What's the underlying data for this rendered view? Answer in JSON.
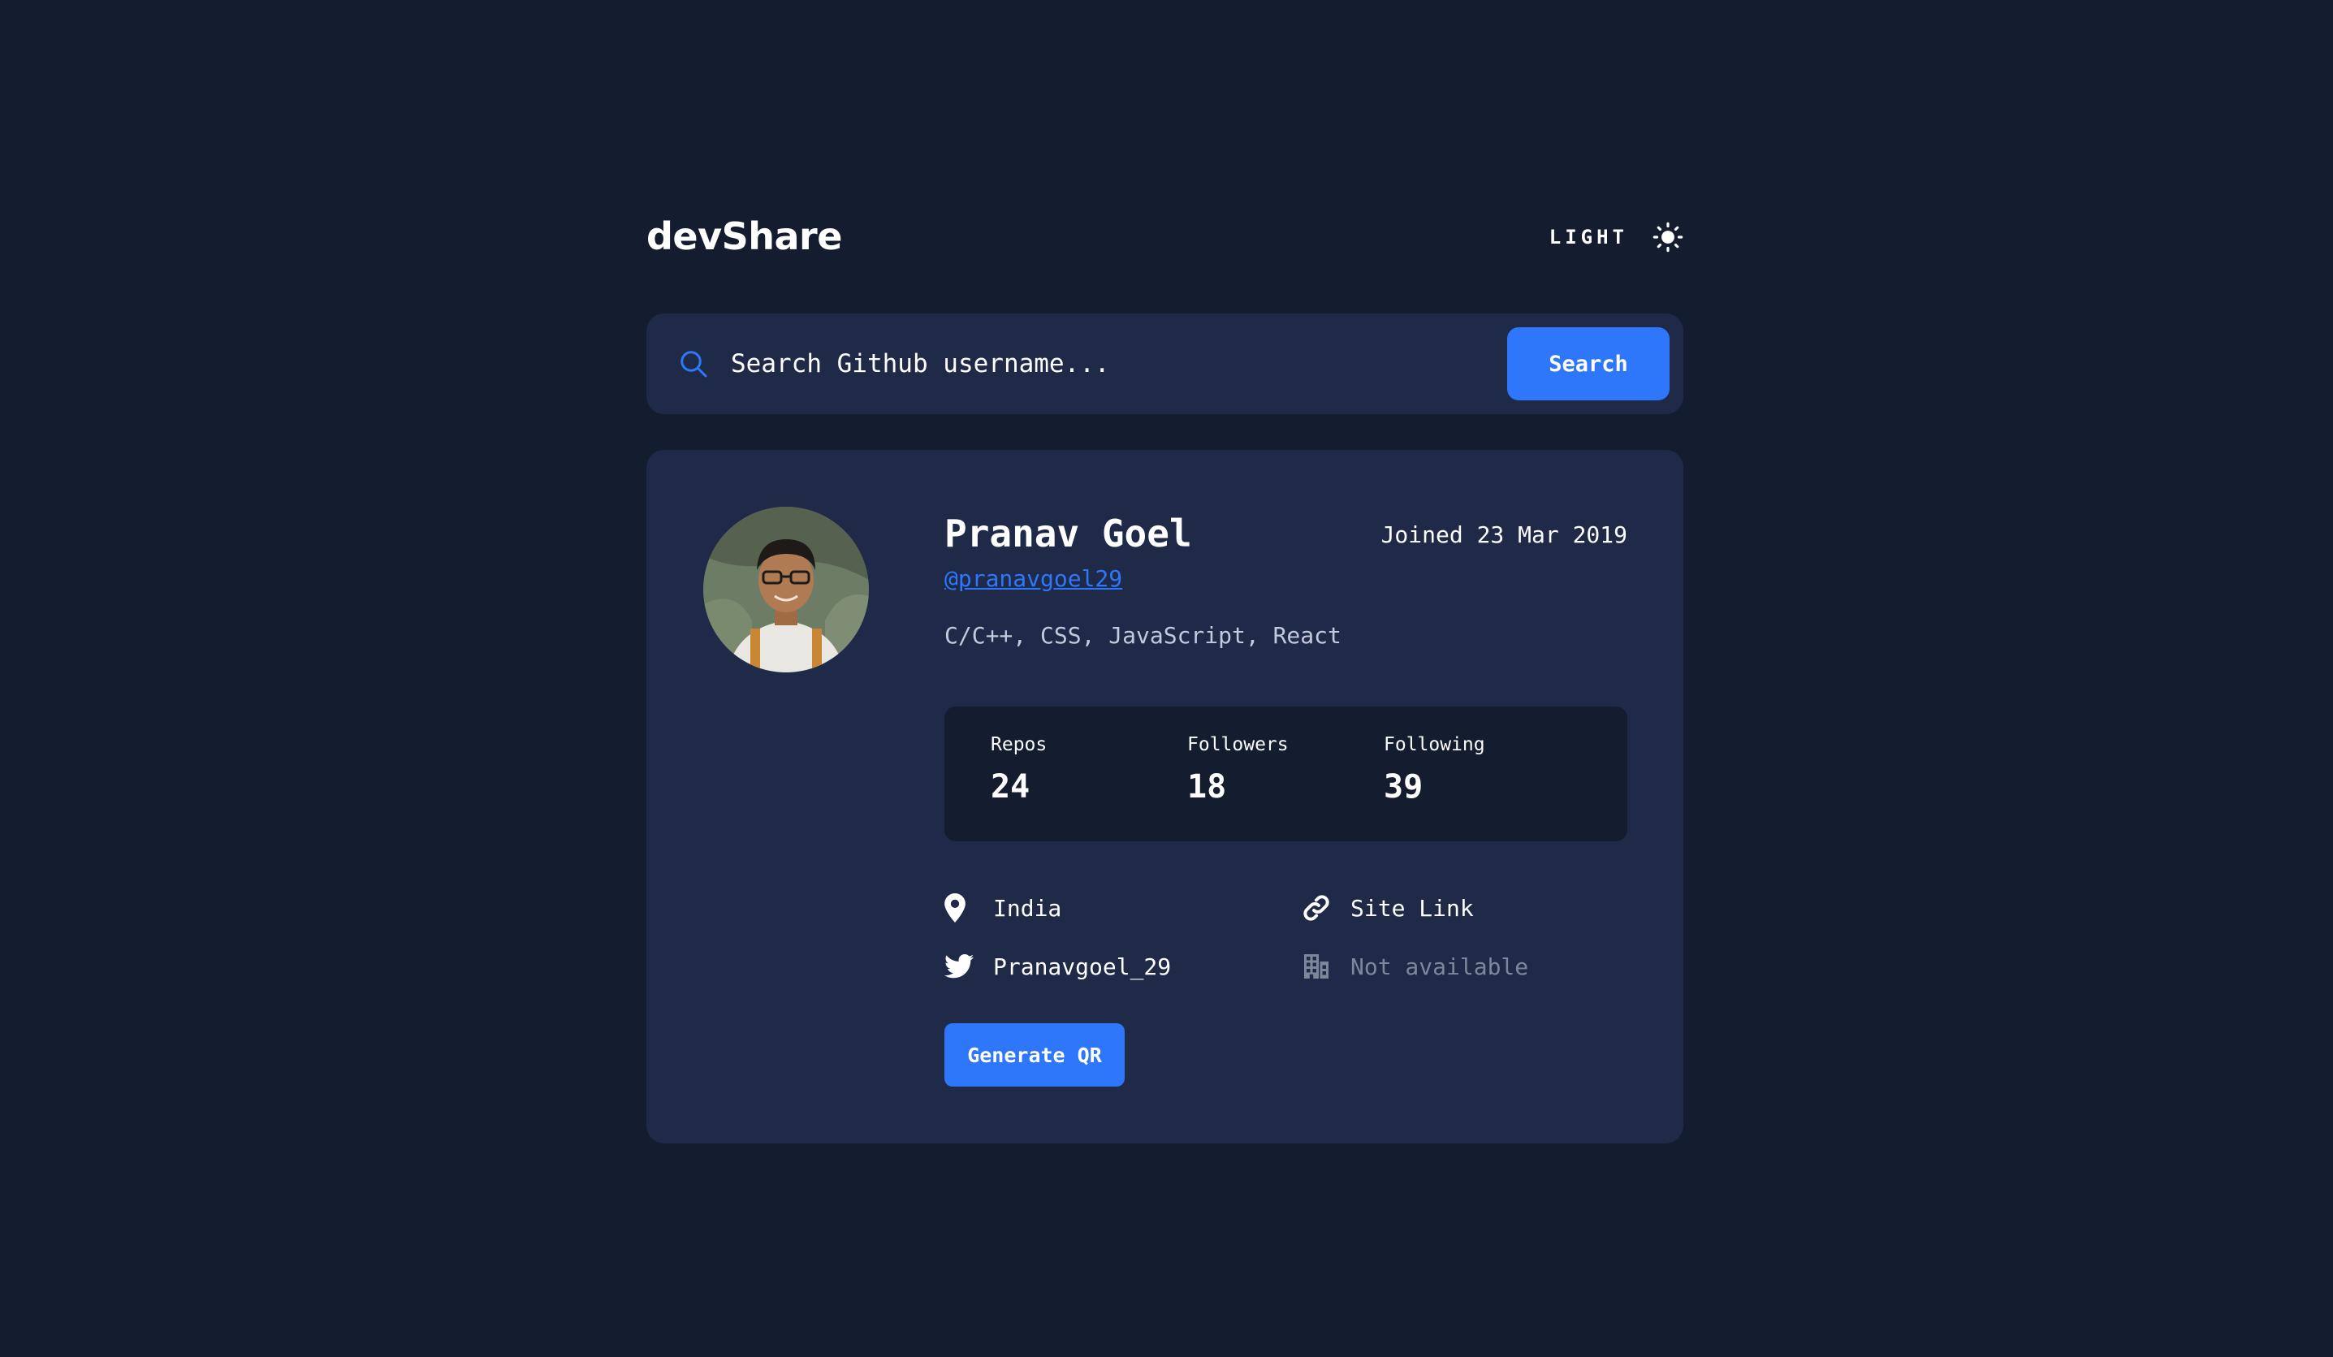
{
  "header": {
    "brand": "devShare",
    "theme_label": "LIGHT",
    "theme_icon": "sun-icon"
  },
  "search": {
    "icon": "search-icon",
    "placeholder": "Search Github username...",
    "button_label": "Search"
  },
  "profile": {
    "avatar": "profile-avatar",
    "name": "Pranav Goel",
    "joined": "Joined 23 Mar 2019",
    "username": "@pranavgoel29",
    "bio": "C/C++, CSS, JavaScript, React",
    "stats": [
      {
        "label": "Repos",
        "value": "24"
      },
      {
        "label": "Followers",
        "value": "18"
      },
      {
        "label": "Following",
        "value": "39"
      }
    ],
    "location": {
      "icon": "location-pin-icon",
      "text": "India"
    },
    "website": {
      "icon": "link-icon",
      "text": "Site Link"
    },
    "twitter": {
      "icon": "twitter-icon",
      "text": "Pranavgoel_29"
    },
    "company": {
      "icon": "building-icon",
      "text": "Not available"
    },
    "qr_button": "Generate QR"
  },
  "colors": {
    "background": "#141c2f",
    "card": "#1f2a48",
    "accent": "#2e77fa",
    "muted": "#7e879a"
  }
}
